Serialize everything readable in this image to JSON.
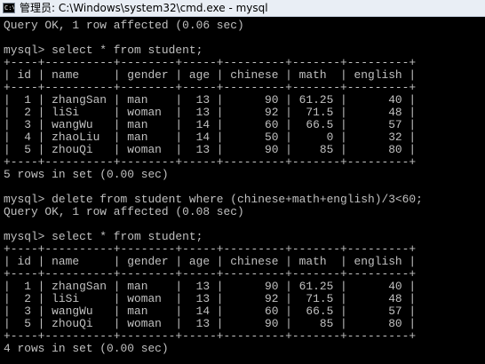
{
  "titlebar": {
    "icon_text": "C:\\",
    "title": "管理员: C:\\Windows\\system32\\cmd.exe - mysql"
  },
  "console": {
    "lines": [
      "Query OK, 1 row affected (0.06 sec)",
      "",
      "mysql> select * from student;",
      "+----+----------+--------+-----+---------+-------+---------+",
      "| id | name     | gender | age | chinese | math  | english |",
      "+----+----------+--------+-----+---------+-------+---------+",
      "|  1 | zhangSan | man    |  13 |      90 | 61.25 |      40 |",
      "|  2 | liSi     | woman  |  13 |      92 |  71.5 |      48 |",
      "|  3 | wangWu   | man    |  14 |      60 |  66.5 |      57 |",
      "|  4 | zhaoLiu  | man    |  14 |      50 |     0 |      32 |",
      "|  5 | zhouQi   | woman  |  13 |      90 |    85 |      80 |",
      "+----+----------+--------+-----+---------+-------+---------+",
      "5 rows in set (0.00 sec)",
      "",
      "mysql> delete from student where (chinese+math+english)/3<60;",
      "Query OK, 1 row affected (0.08 sec)",
      "",
      "mysql> select * from student;",
      "+----+----------+--------+-----+---------+-------+---------+",
      "| id | name     | gender | age | chinese | math  | english |",
      "+----+----------+--------+-----+---------+-------+---------+",
      "|  1 | zhangSan | man    |  13 |      90 | 61.25 |      40 |",
      "|  2 | liSi     | woman  |  13 |      92 |  71.5 |      48 |",
      "|  3 | wangWu   | man    |  14 |      60 |  66.5 |      57 |",
      "|  5 | zhouQi   | woman  |  13 |      90 |    85 |      80 |",
      "+----+----------+--------+-----+---------+-------+---------+",
      "4 rows in set (0.00 sec)",
      ""
    ]
  }
}
